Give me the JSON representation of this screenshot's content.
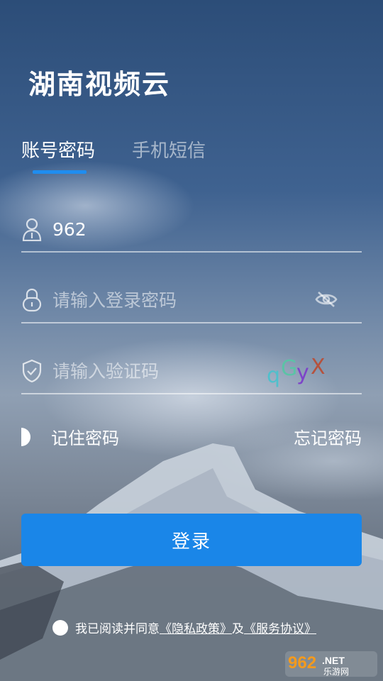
{
  "app_title": "湖南视频云",
  "tabs": [
    {
      "label": "账号密码",
      "active": true
    },
    {
      "label": "手机短信",
      "active": false
    }
  ],
  "account": {
    "value": "962",
    "icon": "user-icon"
  },
  "password": {
    "placeholder": "请输入登录密码",
    "icon": "lock-icon",
    "toggle_icon": "eye-off-icon"
  },
  "captcha_field": {
    "placeholder": "请输入验证码",
    "icon": "shield-icon",
    "captcha_text": "qGyX"
  },
  "remember": {
    "label": "记住密码"
  },
  "forgot": {
    "label": "忘记密码"
  },
  "login": {
    "label": "登录"
  },
  "agreement": {
    "prefix": "我已阅读并同意",
    "privacy_link": "《隐私政策》",
    "conjunction": "及",
    "service_link": "《服务协议》"
  },
  "watermark": {
    "brand": "962",
    "suffix": ".NET",
    "sub": "乐游网"
  },
  "colors": {
    "accent": "#1a86e8",
    "underline": "#1f8df0"
  }
}
